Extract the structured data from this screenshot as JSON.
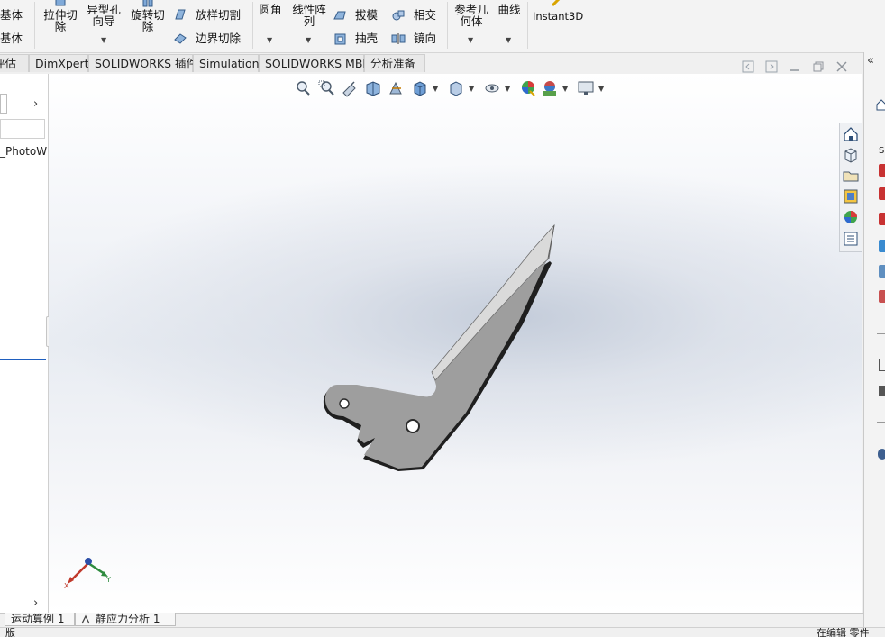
{
  "ribbon": {
    "extrude_boss_partial": "基体",
    "revolve_boss_partial": "基体",
    "extrude_cut": [
      "拉伸切",
      "除"
    ],
    "hole_wizard": [
      "异型孔",
      "向导"
    ],
    "revolve_cut": [
      "旋转切",
      "除"
    ],
    "lofted_cut": "放样切割",
    "boundary_cut": "边界切除",
    "fillet": "圆角",
    "linear_pattern": [
      "线性阵",
      "列"
    ],
    "draft": "拔模",
    "shell": "抽壳",
    "intersect": "相交",
    "mirror": "镜向",
    "reference_geometry": [
      "参考几",
      "何体"
    ],
    "curves": "曲线",
    "instant3d": "Instant3D"
  },
  "tabs": [
    {
      "label": "评估"
    },
    {
      "label": "DimXpert"
    },
    {
      "label": "SOLIDWORKS 插件"
    },
    {
      "label": "Simulation"
    },
    {
      "label": "SOLIDWORKS MBD"
    },
    {
      "label": "分析准备"
    }
  ],
  "left_panel": {
    "tree_item_partial": "_PhotoW"
  },
  "bottom_tabs": [
    {
      "label": "运动算例 1"
    },
    {
      "label": "静应力分析 1"
    }
  ],
  "status": {
    "left_partial": "版",
    "right_partial": "在编辑 零件"
  },
  "triad": {
    "x": "X",
    "y": "Y"
  },
  "colors": {
    "part_face": "#9e9e9e",
    "part_bevel": "#dadada",
    "accent_blue": "#1f5fbf"
  }
}
